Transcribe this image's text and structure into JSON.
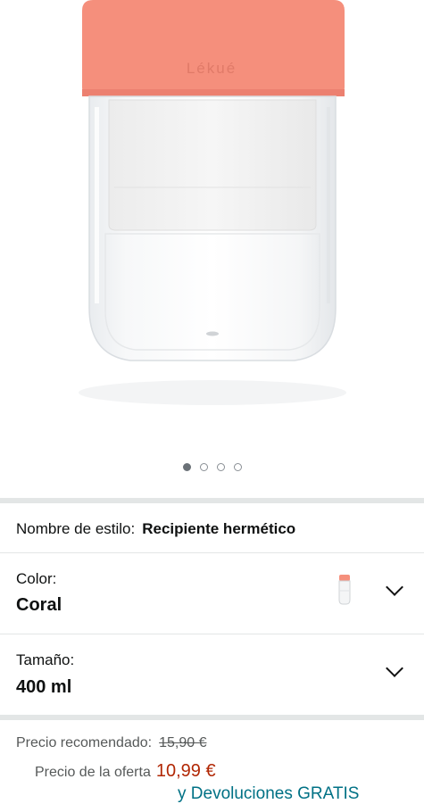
{
  "gallery": {
    "brand_mark": "Lékué",
    "page_count": 4,
    "active_index": 0
  },
  "style_row": {
    "label": "Nombre de estilo:",
    "value": "Recipiente hermético"
  },
  "color_row": {
    "label": "Color:",
    "value": "Coral"
  },
  "size_row": {
    "label": "Tamaño:",
    "value": "400 ml"
  },
  "pricing": {
    "list_label": "Precio recomendado:",
    "list_price": "15,90 €",
    "offer_label": "Precio de la oferta",
    "offer_price": "10,99 €",
    "returns_text": "y Devoluciones GRATIS"
  },
  "colors": {
    "coral": "#f58f7c",
    "link": "#007185",
    "price_red": "#b12704"
  }
}
